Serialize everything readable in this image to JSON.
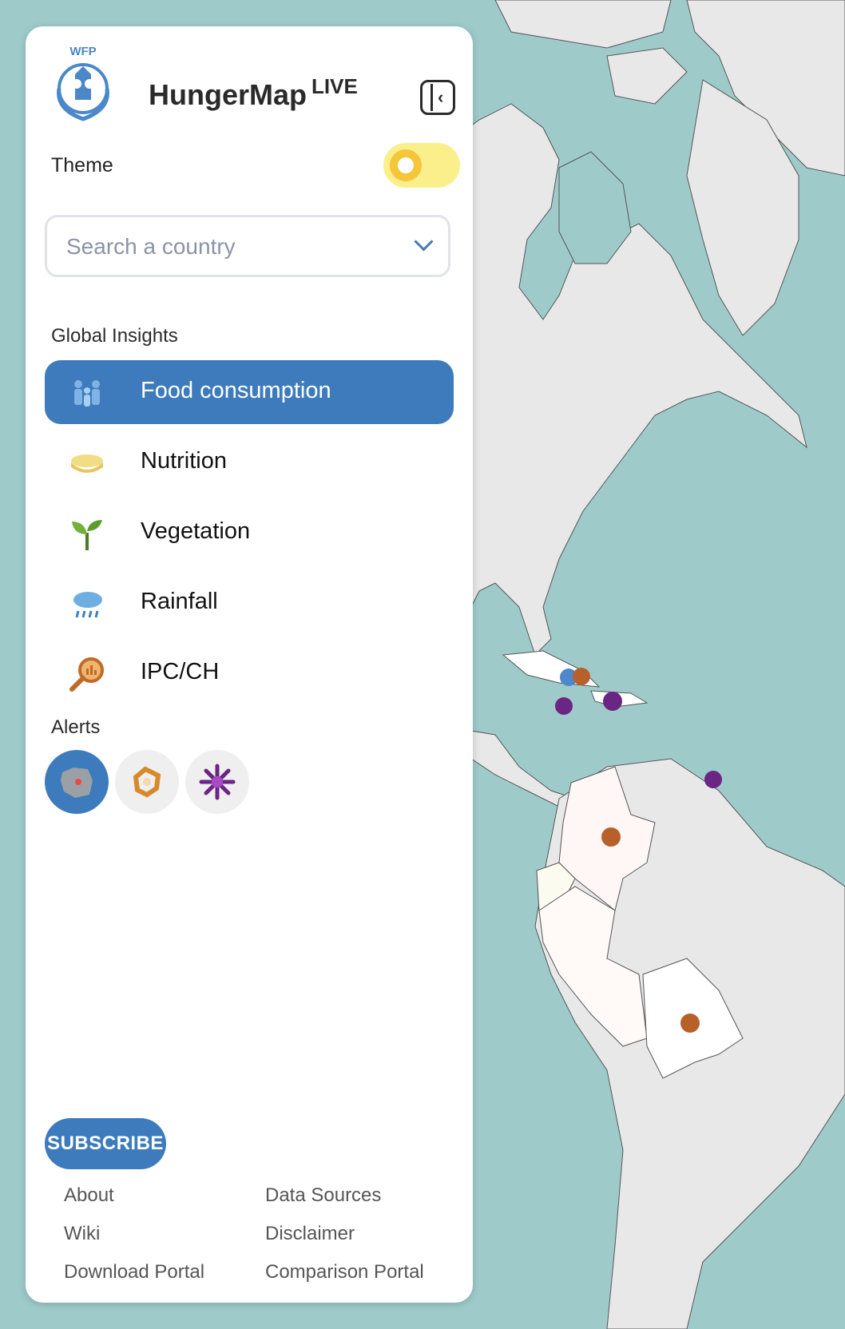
{
  "app": {
    "org": "WFP",
    "title": "HungerMap",
    "title_suffix": "LIVE"
  },
  "theme": {
    "label": "Theme",
    "mode": "light"
  },
  "search": {
    "placeholder": "Search a country",
    "value": ""
  },
  "global_insights": {
    "label": "Global Insights",
    "items": [
      {
        "label": "Food consumption",
        "icon": "food-consumption-icon",
        "active": true
      },
      {
        "label": "Nutrition",
        "icon": "nutrition-icon",
        "active": false
      },
      {
        "label": "Vegetation",
        "icon": "vegetation-icon",
        "active": false
      },
      {
        "label": "Rainfall",
        "icon": "rainfall-icon",
        "active": false
      },
      {
        "label": "IPC/CH",
        "icon": "ipc-ch-icon",
        "active": false
      }
    ]
  },
  "alerts": {
    "label": "Alerts",
    "items": [
      {
        "icon": "hunger-alert-icon",
        "active": true
      },
      {
        "icon": "conflict-alert-icon",
        "active": false
      },
      {
        "icon": "hazard-alert-icon",
        "active": false
      }
    ]
  },
  "subscribe_label": "SUBSCRIBE",
  "footer": {
    "left": [
      "About",
      "Wiki",
      "Download Portal"
    ],
    "right": [
      "Data Sources",
      "Disclaimer",
      "Comparison Portal"
    ]
  },
  "colors": {
    "accent": "#3d7bbc",
    "ocean": "#9ecbca",
    "land": "#e8e8e8",
    "highlighted_land": "#ffffff",
    "marker_orange": "#b8602a",
    "marker_purple": "#6b2582",
    "marker_blue": "#4d88cc",
    "toggle_track": "#fbef8c",
    "toggle_knob": "#f5c53a"
  }
}
